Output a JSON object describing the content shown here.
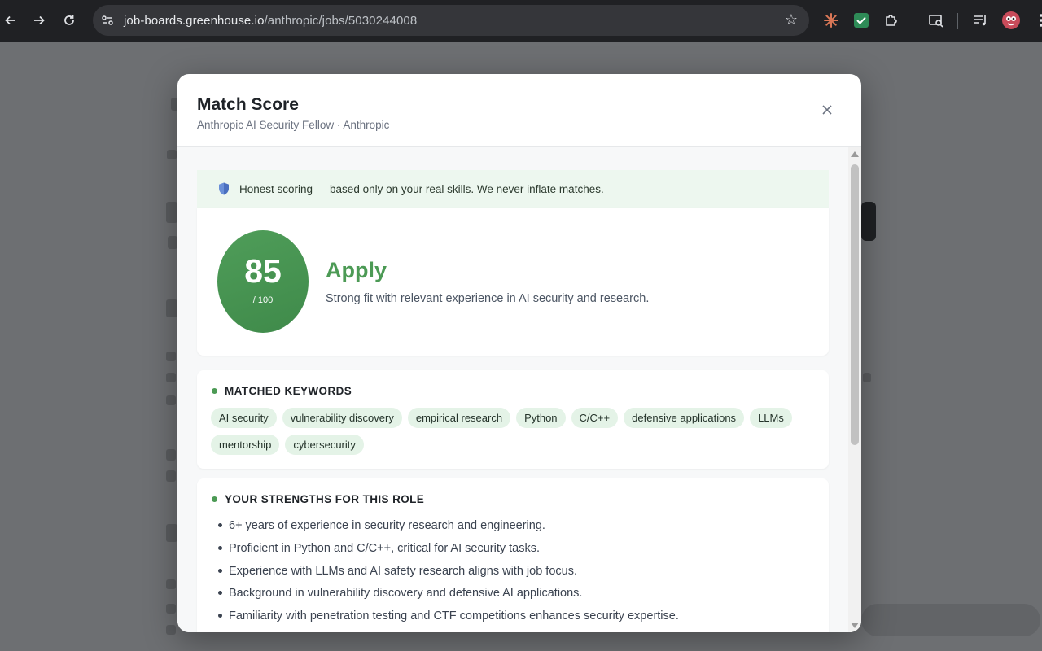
{
  "browser": {
    "url_host": "job-boards.greenhouse.io",
    "url_path": "/anthropic/jobs/5030244008"
  },
  "modal": {
    "title": "Match Score",
    "subtitle": "Anthropic AI Security Fellow · Anthropic",
    "close_icon": "close-icon",
    "banner_text": "Honest scoring — based only on your real skills. We never inflate matches.",
    "score": "85",
    "score_max": "/ 100",
    "verdict": "Apply",
    "verdict_description": "Strong fit with relevant experience in AI security and research.",
    "matched_keywords_title": "MATCHED KEYWORDS",
    "keywords": [
      "AI security",
      "vulnerability discovery",
      "empirical research",
      "Python",
      "C/C++",
      "defensive applications",
      "LLMs",
      "mentorship",
      "cybersecurity"
    ],
    "strengths_title": "YOUR STRENGTHS FOR THIS ROLE",
    "strengths": [
      "6+ years of experience in security research and engineering.",
      "Proficient in Python and C/C++, critical for AI security tasks.",
      "Experience with LLMs and AI safety research aligns with job focus.",
      "Background in vulnerability discovery and defensive AI applications.",
      "Familiarity with penetration testing and CTF competitions enhances security expertise."
    ]
  },
  "colors": {
    "accent_green": "#4c9a55",
    "chip_bg": "#e4f3e7",
    "banner_bg": "#edf7ef"
  }
}
